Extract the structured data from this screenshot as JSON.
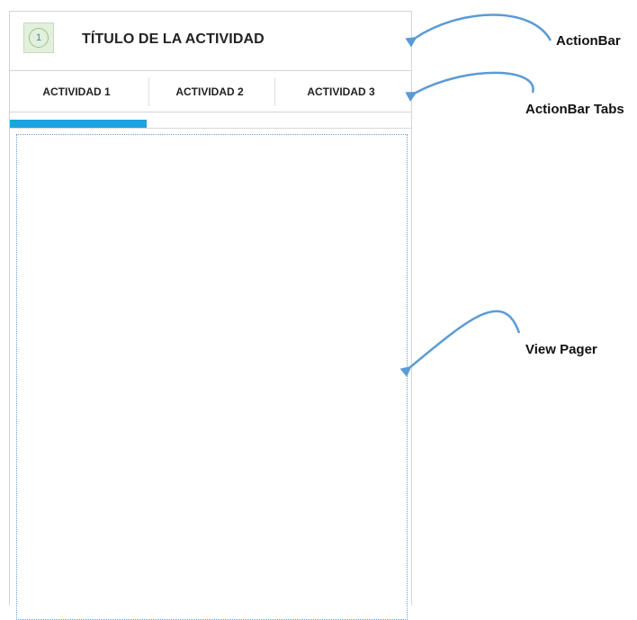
{
  "actionbar": {
    "icon_number": "1",
    "title": "TÍTULO DE LA ACTIVIDAD"
  },
  "tabs": [
    {
      "label": "ACTIVIDAD 1",
      "selected": true
    },
    {
      "label": "ACTIVIDAD 2",
      "selected": false
    },
    {
      "label": "ACTIVIDAD 3",
      "selected": false
    }
  ],
  "annotations": {
    "actionbar": "ActionBar",
    "tabs": "ActionBar Tabs",
    "viewpager": "View Pager"
  },
  "colors": {
    "tab_indicator": "#1ba3e0",
    "arrow": "#5b9bd5",
    "viewpager_border": "#6b9fd4"
  }
}
